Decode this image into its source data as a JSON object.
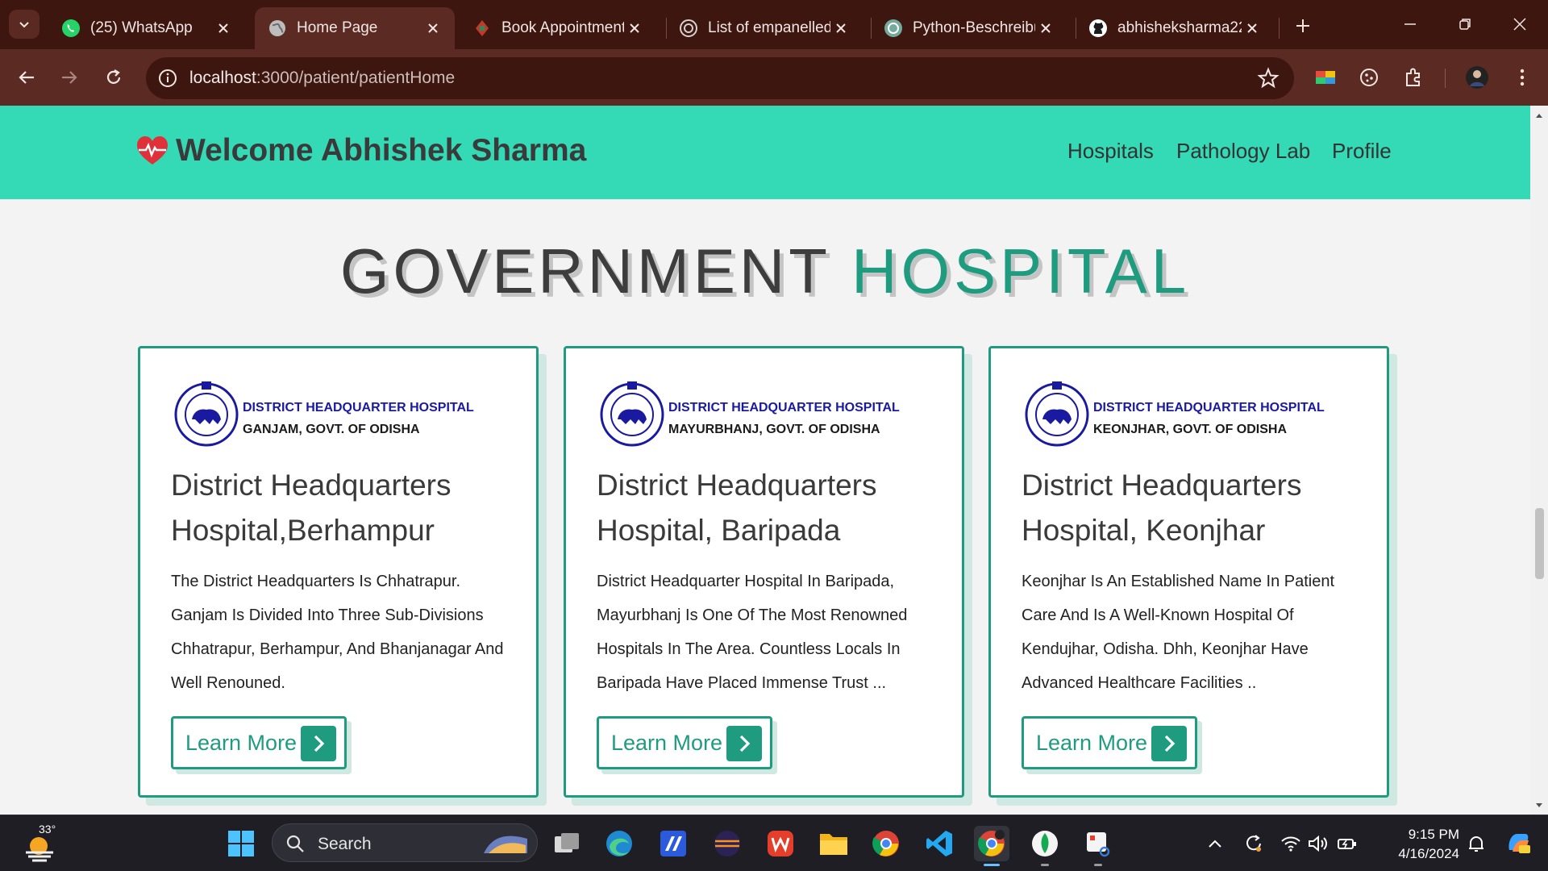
{
  "browser": {
    "tabs": [
      {
        "title": "(25) WhatsApp",
        "icon": "whatsapp-icon",
        "active": false
      },
      {
        "title": "Home Page",
        "icon": "globe-icon",
        "active": true
      },
      {
        "title": "Book Appointment",
        "icon": "book-appointment-icon",
        "active": false
      },
      {
        "title": "List of empanelled",
        "icon": "emblem-icon",
        "active": false
      },
      {
        "title": "Python-Beschreibu",
        "icon": "chatgpt-icon",
        "active": false
      },
      {
        "title": "abhisheksharma22",
        "icon": "github-icon",
        "active": false
      }
    ],
    "url_host": "localhost",
    "url_path": ":3000/patient/patientHome"
  },
  "site": {
    "brand": "Welcome Abhishek Sharma",
    "nav": [
      "Hospitals",
      "Pathology Lab",
      "Profile"
    ],
    "headline_part1": "GOVERNMENT",
    "headline_part2": "HOSPITAL",
    "accent_color": "#1f9c80",
    "navbar_color": "#34d9b5"
  },
  "cards": [
    {
      "org_line1": "DISTRICT HEADQUARTER HOSPITAL",
      "org_line2": "GANJAM, GOVT. OF ODISHA",
      "title": "District Headquarters Hospital,Berhampur",
      "description": "The District Headquarters Is Chhatrapur. Ganjam Is Divided Into Three Sub-Divisions Chhatrapur, Berhampur, And Bhanjanagar And Well Renouned.",
      "button": "Learn More"
    },
    {
      "org_line1": "DISTRICT HEADQUARTER HOSPITAL",
      "org_line2": "MAYURBHANJ, GOVT. OF ODISHA",
      "title": "District Headquarters Hospital, Baripada",
      "description": "District Headquarter Hospital In Baripada, Mayurbhanj Is One Of The Most Renowned Hospitals In The Area. Countless Locals In Baripada Have Placed Immense Trust ...",
      "button": "Learn More"
    },
    {
      "org_line1": "DISTRICT HEADQUARTER HOSPITAL",
      "org_line2": "KEONJHAR, GOVT. OF ODISHA",
      "title": "District Headquarters Hospital, Keonjhar",
      "description": "Keonjhar Is An Established Name In Patient Care And Is A Well-Known Hospital Of Kendujhar, Odisha. Dhh, Keonjhar Have Advanced Healthcare Facilities ..",
      "button": "Learn More"
    }
  ],
  "taskbar": {
    "temperature": "33°",
    "search_placeholder": "Search",
    "time": "9:15 PM",
    "date": "4/16/2024"
  }
}
